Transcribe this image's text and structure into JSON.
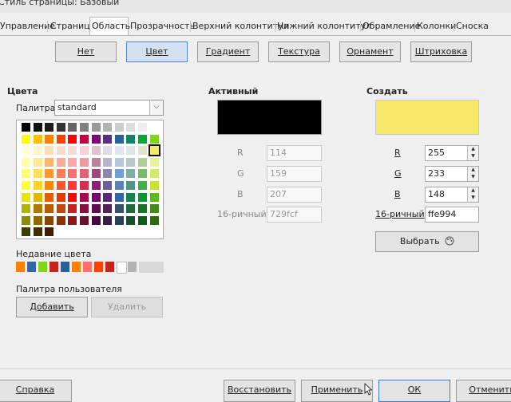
{
  "window": {
    "title": "Стиль страницы: Базовый"
  },
  "tabs": [
    "Управление",
    "Страница",
    "Область",
    "Прозрачность",
    "Верхний колонтитул",
    "Нижний колонтитул",
    "Обрамление",
    "Колонки",
    "Сноска"
  ],
  "fill_types": [
    "Нет",
    "Цвет",
    "Градиент",
    "Текстура",
    "Орнамент",
    "Штриховка"
  ],
  "colors_section": {
    "title": "Цвета",
    "palette_label": "Палитра:",
    "palette_value": "standard",
    "recent_label": "Недавние цвета",
    "custom_palette_label": "Палитра пользователя",
    "add_button": "Добавить",
    "delete_button": "Удалить",
    "recent_colors": [
      "#ff8000",
      "#3465a4",
      "#81d41a",
      "#c9211e",
      "#2a6099",
      "#ff8000",
      "#ff6d6d",
      "#ff4000",
      "#c9211e",
      "#ffffff",
      "#b2b2b2"
    ]
  },
  "active_section": {
    "title": "Активный",
    "r_label": "R",
    "g_label": "G",
    "b_label": "B",
    "hex_label": "16-ричный",
    "r": "114",
    "g": "159",
    "b": "207",
    "hex": "729fcf",
    "preview_color": "#000000"
  },
  "new_section": {
    "title": "Создать",
    "r_label": "R",
    "g_label": "G",
    "b_label": "B",
    "hex_label": "16-ричный",
    "r": "255",
    "g": "233",
    "b": "148",
    "hex": "ffe994",
    "preview_color": "#f5e96c",
    "pick_button": "Выбрать"
  },
  "dialog_buttons": {
    "help": "Справка",
    "reset": "Восстановить",
    "apply": "Применить",
    "ok": "ОК",
    "cancel": "Отменить"
  }
}
